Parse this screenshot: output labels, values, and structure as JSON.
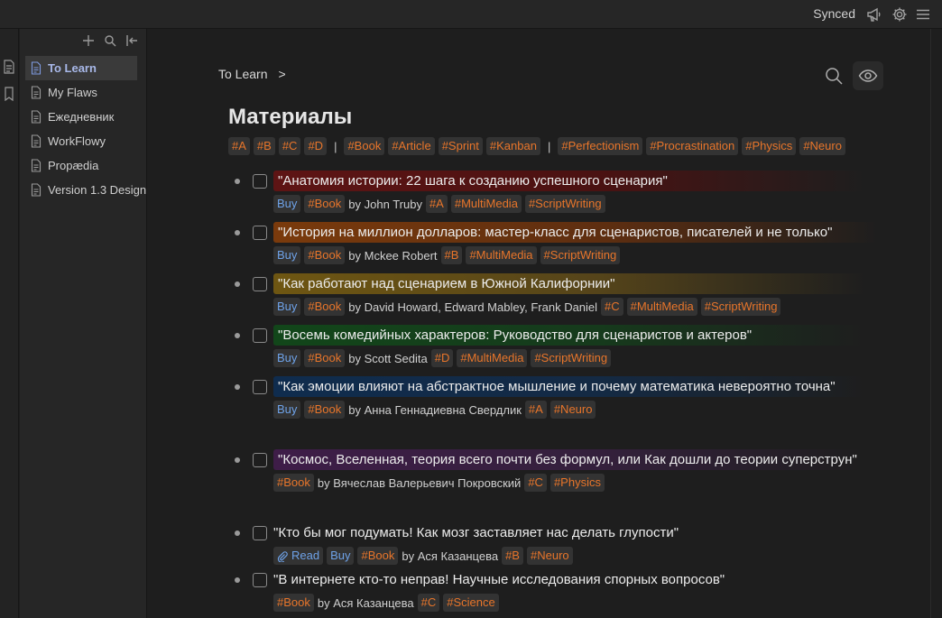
{
  "topbar": {
    "status": "Synced"
  },
  "sidebar": {
    "items": [
      {
        "label": "To Learn",
        "active": true
      },
      {
        "label": "My Flaws",
        "active": false
      },
      {
        "label": "Ежедневник",
        "active": false
      },
      {
        "label": "WorkFlowy",
        "active": false
      },
      {
        "label": "Propædia",
        "active": false
      },
      {
        "label": "Version 1.3 Design",
        "active": false
      }
    ]
  },
  "breadcrumb": {
    "parent": "To Learn",
    "separator": ">"
  },
  "page": {
    "title": "Материалы",
    "tag_groups": [
      [
        "#A",
        "#B",
        "#C",
        "#D"
      ],
      [
        "#Book",
        "#Article",
        "#Sprint",
        "#Kanban"
      ],
      [
        "#Perfectionism",
        "#Procrastination",
        "#Physics",
        "#Neuro"
      ]
    ],
    "tag_separator": "|"
  },
  "items": [
    {
      "text": "\"Анатомия истории: 22 шага к созданию успешного сценария\"",
      "highlight": "red",
      "read": null,
      "buy": "Buy",
      "book": "#Book",
      "author": "by John Truby",
      "tags": [
        "#A",
        "#MultiMedia",
        "#ScriptWriting"
      ]
    },
    {
      "text": "\"История на миллион долларов: мастер-класс для сценаристов, писателей и не только\"",
      "highlight": "orange",
      "read": null,
      "buy": "Buy",
      "book": "#Book",
      "author": "by Mckee Robert",
      "tags": [
        "#B",
        "#MultiMedia",
        "#ScriptWriting"
      ]
    },
    {
      "text": "\"Как работают над сценарием в Южной Калифорнии\"",
      "highlight": "yellow",
      "read": null,
      "buy": "Buy",
      "book": "#Book",
      "author": "by David Howard, Edward Mabley, Frank Daniel",
      "tags": [
        "#C",
        "#MultiMedia",
        "#ScriptWriting"
      ]
    },
    {
      "text": "\"Восемь комедийных характеров: Руководство для сценаристов и актеров\"",
      "highlight": "green",
      "read": null,
      "buy": "Buy",
      "book": "#Book",
      "author": "by Scott Sedita",
      "tags": [
        "#D",
        "#MultiMedia",
        "#ScriptWriting"
      ]
    },
    {
      "text": "\"Как эмоции влияют на абстрактное мышление и почему математика невероятно точна\"",
      "highlight": "blue",
      "read": null,
      "buy": "Buy",
      "book": "#Book",
      "author": "by Анна Геннадиевна Свердлик",
      "tags": [
        "#A",
        "#Neuro"
      ]
    },
    {
      "text": "\"Космос, Вселенная, теория всего почти без формул, или Как дошли до теории суперструн\"",
      "highlight": "purple",
      "read": null,
      "buy": null,
      "book": "#Book",
      "author": "by Вячеслав Валерьевич Покровский",
      "tags": [
        "#C",
        "#Physics"
      ]
    },
    {
      "text": "\"Кто бы мог подумать! Как мозг заставляет нас делать глупости\"",
      "highlight": "none",
      "read": "Read",
      "buy": "Buy",
      "book": "#Book",
      "author": "by Ася Казанцева",
      "tags": [
        "#B",
        "#Neuro"
      ]
    },
    {
      "text": "\"В интернете кто-то неправ! Научные исследования спорных вопросов\"",
      "highlight": "none",
      "read": null,
      "buy": null,
      "book": "#Book",
      "author": "by Ася Казанцева",
      "tags": [
        "#C",
        "#Science"
      ]
    }
  ],
  "colors": {
    "tag": "#e8752a",
    "link": "#6ea2e8",
    "accent": "#7e9be0",
    "background": "#1e1e1e"
  },
  "icons": {
    "top": [
      "megaphone-icon",
      "gear-icon",
      "menu-icon"
    ],
    "sidebar_tools": [
      "plus-icon",
      "search-icon",
      "collapse-icon"
    ],
    "view": [
      "search-icon",
      "eye-icon"
    ]
  }
}
